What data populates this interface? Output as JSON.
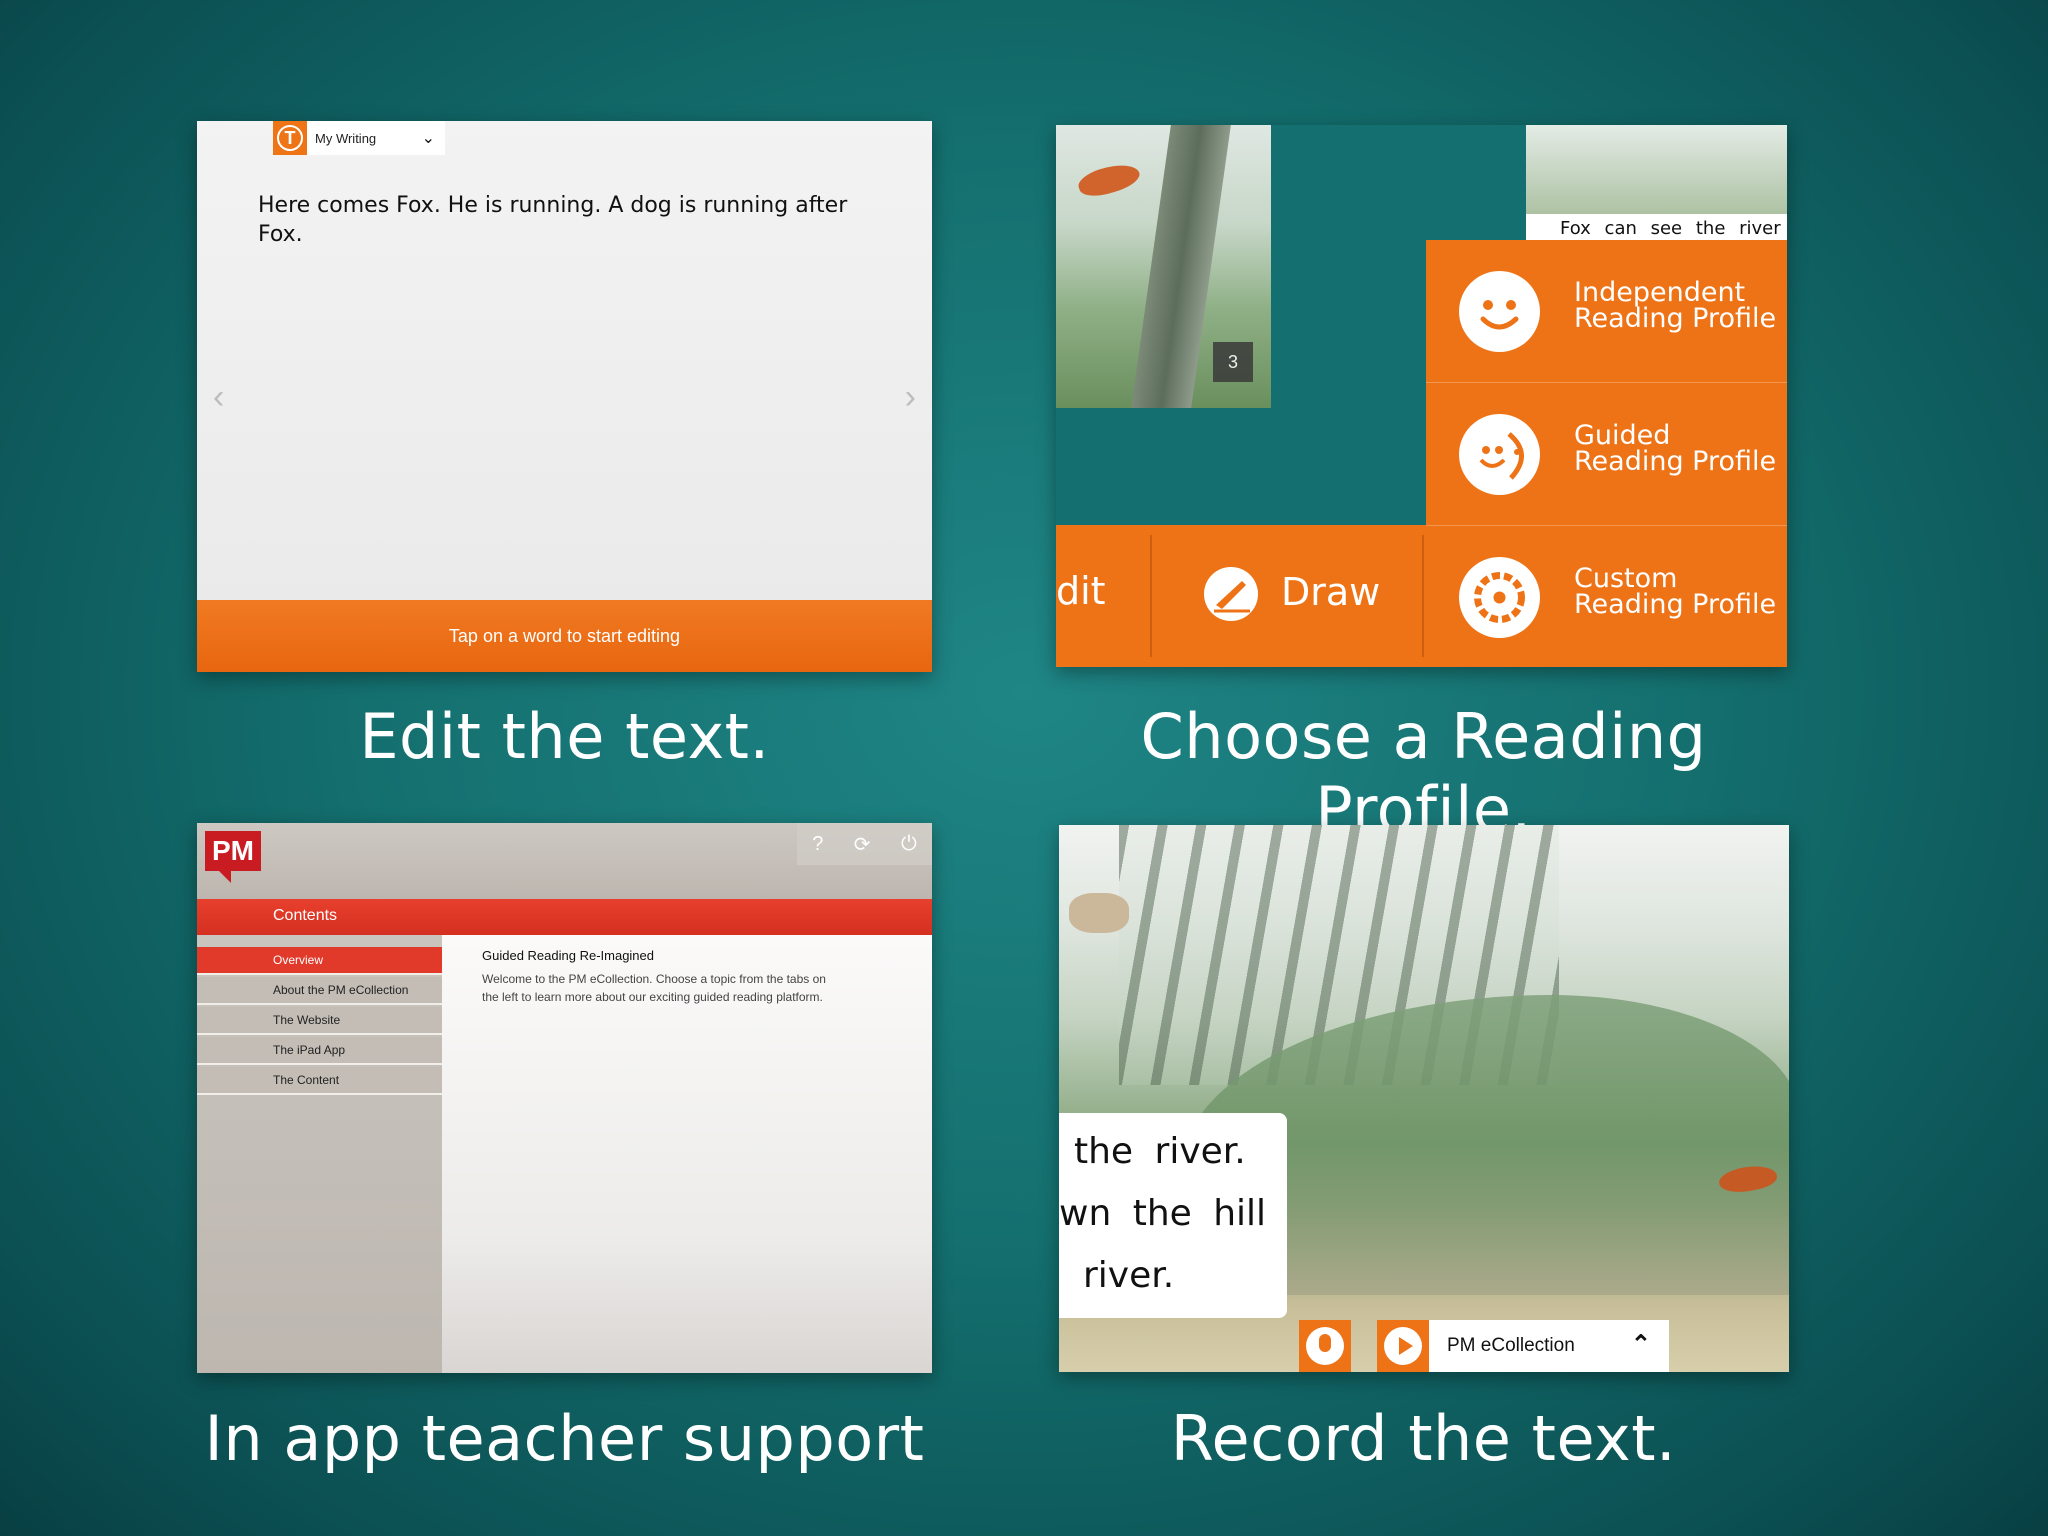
{
  "panels": {
    "edit": {
      "dropdown_label": "My Writing",
      "story_text": "Here comes Fox. He is running. A dog is running after Fox.",
      "bottom_hint": "Tap on a word to start editing",
      "caption": "Edit the text."
    },
    "profile": {
      "page_number": "3",
      "book_text_fragment": "Fox can see the river",
      "menu_items": [
        {
          "line1": "Independent",
          "line2": "Reading Profile",
          "icon": "smiley-icon"
        },
        {
          "line1": "Guided",
          "line2": "Reading Profile",
          "icon": "two-faces-icon"
        },
        {
          "line1": "Custom",
          "line2": "Reading Profile",
          "icon": "gear-icon"
        }
      ],
      "edit_fragment": "dit",
      "draw_label": "Draw",
      "caption": "Choose a Reading Profile."
    },
    "teacher": {
      "logo": "PM",
      "header_title": "Contents",
      "nav_items": [
        "Overview",
        "About the PM eCollection",
        "The Website",
        "The iPad App",
        "The Content"
      ],
      "active_nav": "Overview",
      "content_title": "Guided Reading Re-Imagined",
      "content_body": "Welcome to the PM eCollection. Choose a topic from the tabs on the left to learn more about our exciting guided reading platform.",
      "toolbar_help": "?",
      "toolbar_sync": "⟳",
      "toolbar_power": "⏻",
      "caption": "In app teacher support"
    },
    "record": {
      "text_lines": [
        "the river.",
        "wn the hill",
        "river."
      ],
      "collection_label": "PM eCollection",
      "caption": "Record the text."
    }
  },
  "colors": {
    "background": "#14706f",
    "accent_orange": "#ee7317",
    "pm_red": "#c91c22"
  }
}
